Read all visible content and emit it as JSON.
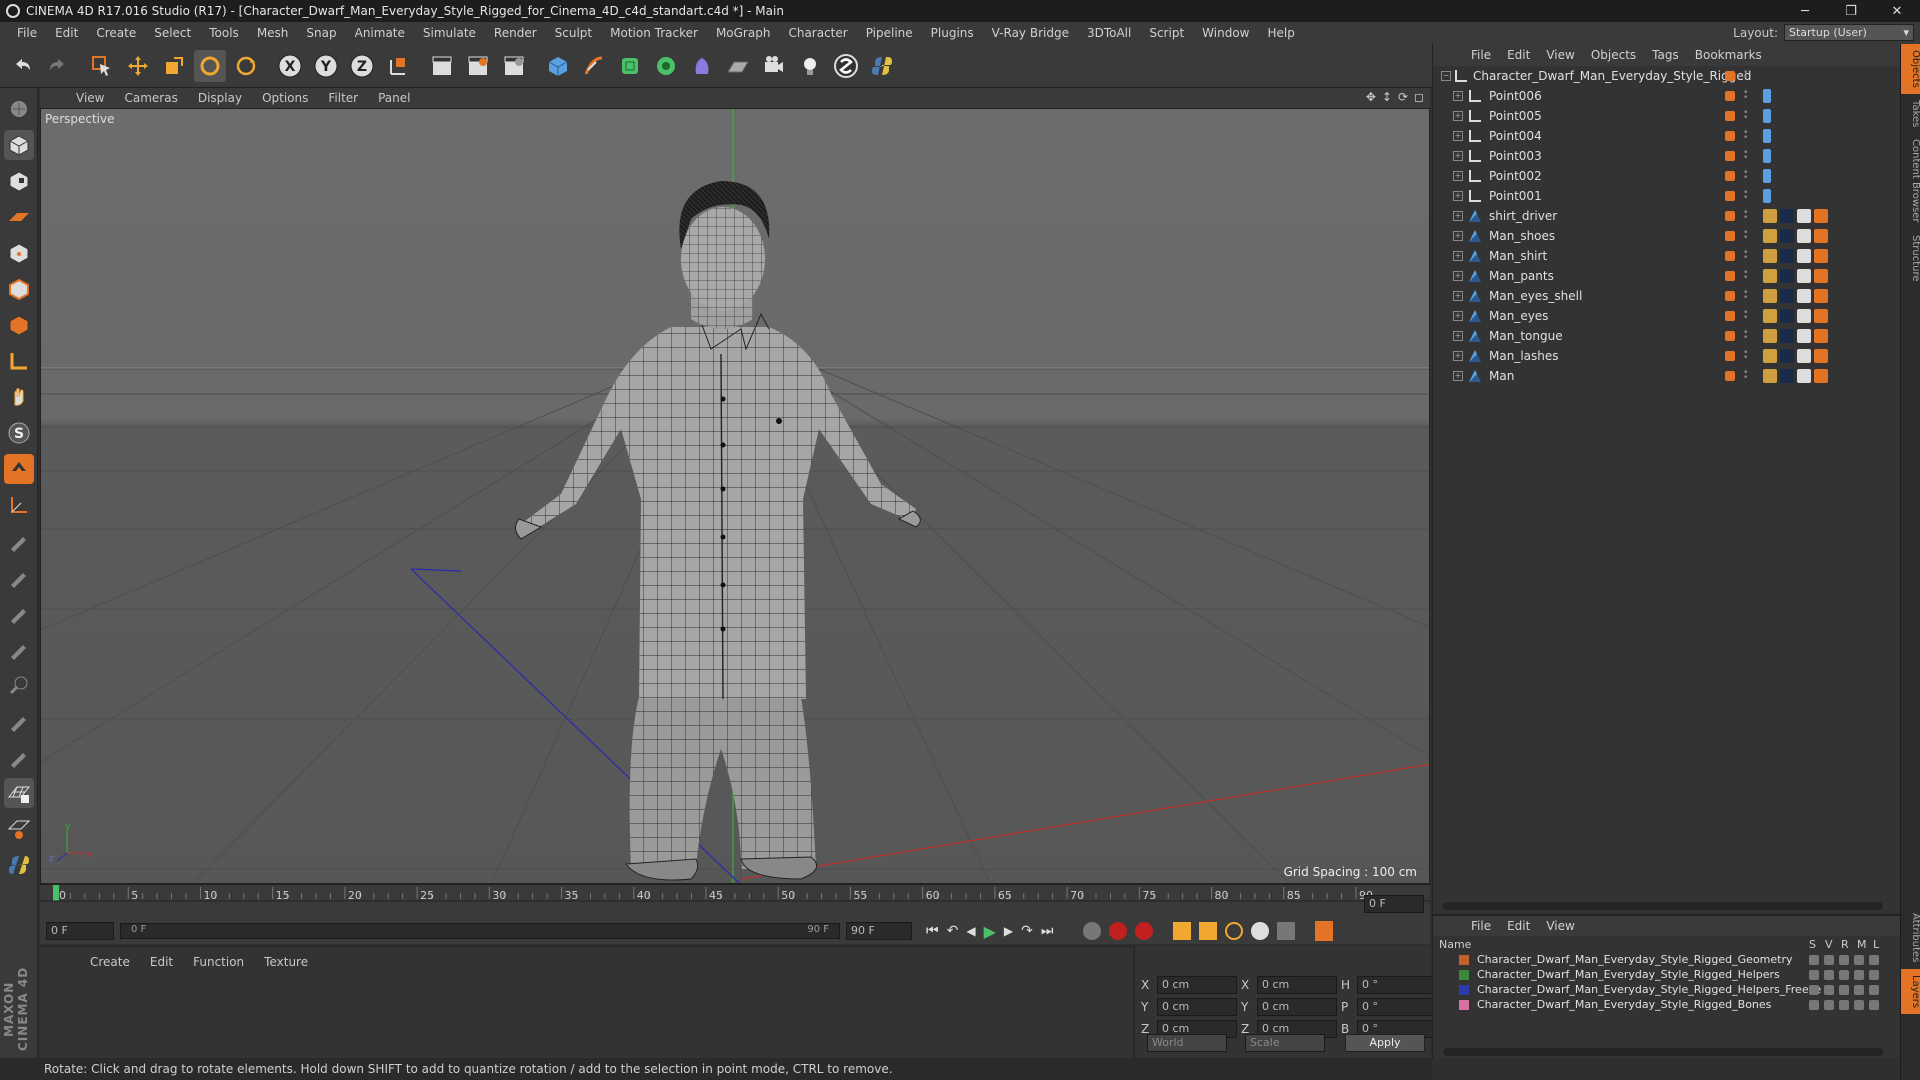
{
  "window": {
    "title": "CINEMA 4D R17.016 Studio (R17) - [Character_Dwarf_Man_Everyday_Style_Rigged_for_Cinema_4D_c4d_standart.c4d *] - Main",
    "minimize": "─",
    "maximize": "❐",
    "close": "✕"
  },
  "menu": [
    "File",
    "Edit",
    "Create",
    "Select",
    "Tools",
    "Mesh",
    "Snap",
    "Animate",
    "Simulate",
    "Render",
    "Sculpt",
    "Motion Tracker",
    "MoGraph",
    "Character",
    "Pipeline",
    "Plugins",
    "V-Ray Bridge",
    "3DToAll",
    "Script",
    "Window",
    "Help"
  ],
  "layout": {
    "label": "Layout:",
    "value": "Startup (User)"
  },
  "viewport": {
    "menu": [
      "View",
      "Cameras",
      "Display",
      "Options",
      "Filter",
      "Panel"
    ],
    "label": "Perspective",
    "grid_spacing": "Grid Spacing : 100 cm",
    "axis_x": "x",
    "axis_y": "y",
    "axis_z": "z"
  },
  "timeline": {
    "ticks": [
      "0",
      "5",
      "10",
      "15",
      "20",
      "25",
      "30",
      "35",
      "40",
      "45",
      "50",
      "55",
      "60",
      "65",
      "70",
      "75",
      "80",
      "85",
      "90"
    ],
    "current_frame": "0 F"
  },
  "transport": {
    "start": "0 F",
    "range_start": "0 F",
    "range_end": "90 F",
    "end": "90 F"
  },
  "material_menu": [
    "Create",
    "Edit",
    "Function",
    "Texture"
  ],
  "coordinates": {
    "x_pos": "0 cm",
    "y_pos": "0 cm",
    "z_pos": "0 cm",
    "x_size": "0 cm",
    "y_size": "0 cm",
    "z_size": "0 cm",
    "h": "0 °",
    "p": "0 °",
    "b": "0 °",
    "mode": "World",
    "size_mode": "Scale",
    "apply": "Apply"
  },
  "status": "Rotate: Click and drag to rotate elements. Hold down SHIFT to add to quantize rotation / add to the selection in point mode, CTRL to remove.",
  "objects_menu": [
    "File",
    "Edit",
    "View",
    "Objects",
    "Tags",
    "Bookmarks"
  ],
  "objects": [
    {
      "name": "Character_Dwarf_Man_Everyday_Style_Rigged",
      "type": "null"
    },
    {
      "name": "Point006",
      "type": "null"
    },
    {
      "name": "Point005",
      "type": "null"
    },
    {
      "name": "Point004",
      "type": "null"
    },
    {
      "name": "Point003",
      "type": "null"
    },
    {
      "name": "Point002",
      "type": "null"
    },
    {
      "name": "Point001",
      "type": "null"
    },
    {
      "name": "shirt_driver",
      "type": "mesh"
    },
    {
      "name": "Man_shoes",
      "type": "mesh"
    },
    {
      "name": "Man_shirt",
      "type": "mesh"
    },
    {
      "name": "Man_pants",
      "type": "mesh"
    },
    {
      "name": "Man_eyes_shell",
      "type": "mesh"
    },
    {
      "name": "Man_eyes",
      "type": "mesh"
    },
    {
      "name": "Man_tongue",
      "type": "mesh"
    },
    {
      "name": "Man_lashes",
      "type": "mesh"
    },
    {
      "name": "Man",
      "type": "mesh"
    }
  ],
  "layers_menu": [
    "File",
    "Edit",
    "View"
  ],
  "layers_header": {
    "name": "Name",
    "s": "S",
    "v": "V",
    "r": "R",
    "m": "M",
    "l": "L"
  },
  "layers": [
    {
      "name": "Character_Dwarf_Man_Everyday_Style_Rigged_Geometry",
      "color": "#c0622a"
    },
    {
      "name": "Character_Dwarf_Man_Everyday_Style_Rigged_Helpers",
      "color": "#3a8a3a"
    },
    {
      "name": "Character_Dwarf_Man_Everyday_Style_Rigged_Helpers_Freeze",
      "color": "#2a3aa8"
    },
    {
      "name": "Character_Dwarf_Man_Everyday_Style_Rigged_Bones",
      "color": "#d86fa0"
    }
  ],
  "side_tabs": [
    "Objects",
    "Takes",
    "Content Browser",
    "Structure",
    "Attributes",
    "Layers"
  ],
  "colors": {
    "accent": "#e37425",
    "panel": "#333333",
    "viewport_bg": "#666666"
  }
}
